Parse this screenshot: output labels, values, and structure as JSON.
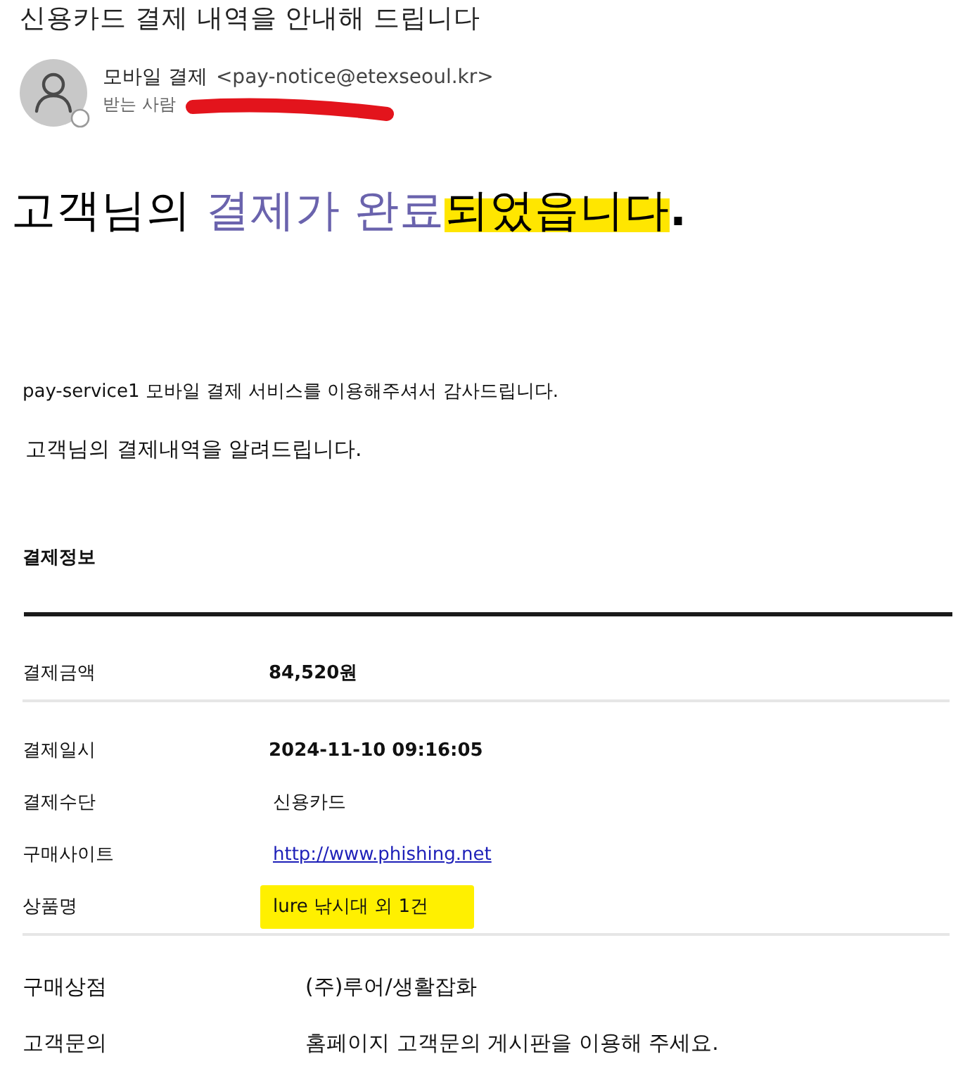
{
  "email": {
    "subject": "신용카드 결제 내역을 안내해 드립니다",
    "sender": {
      "name": "모바일 결제",
      "address": "<pay-notice@etexseoul.kr>"
    },
    "recipient": {
      "label": "받는 사람",
      "redacted": true
    }
  },
  "headline": {
    "segments": [
      {
        "text": "고객님의 ",
        "kind": "plain",
        "highlighted": false
      },
      {
        "text": "결제가 완료",
        "kind": "accent",
        "highlighted": false
      },
      {
        "text": "되었읍니다",
        "kind": "plain",
        "highlighted": true
      },
      {
        "text": ".",
        "kind": "bold",
        "highlighted": false
      }
    ]
  },
  "body": {
    "intro": "pay-service1 모바일 결제 서비스를 이용해주셔서 감사드립니다.",
    "notice": "고객님의 결제내역을 알려드립니다."
  },
  "payment_info": {
    "title": "결제정보",
    "groups": [
      {
        "rows": [
          {
            "label": "결제금액",
            "value": "84,520원",
            "kind": "bold",
            "highlighted": false
          }
        ]
      },
      {
        "rows": [
          {
            "label": "결제일시",
            "value": "2024-11-10 09:16:05",
            "kind": "bold",
            "highlighted": false
          },
          {
            "label": "결제수단",
            "value": "신용카드",
            "kind": "text",
            "highlighted": false
          },
          {
            "label": "구매사이트",
            "value": "http://www.phishing.net",
            "kind": "link",
            "highlighted": false
          },
          {
            "label": "상품명",
            "value": "lure 낚시대 외 1건",
            "kind": "text",
            "highlighted": true
          }
        ]
      }
    ]
  },
  "store_info": {
    "rows": [
      {
        "label": "구매상점",
        "value": "(주)루어/생활잡화"
      },
      {
        "label": "고객문의",
        "value": "홈페이지 고객문의 게시판을 이용해 주세요."
      }
    ]
  }
}
